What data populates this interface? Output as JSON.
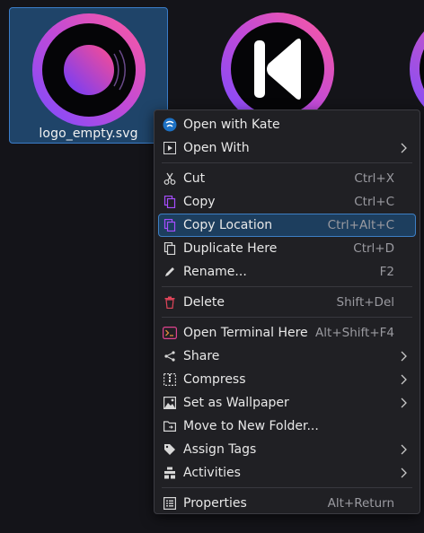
{
  "files": [
    {
      "name": "logo_empty.svg",
      "selected": true,
      "icon": "vinyl-record-icon"
    },
    {
      "name": "",
      "selected": false,
      "icon": "skip-back-icon"
    },
    {
      "name": "",
      "selected": false,
      "icon": "partial-logo-icon"
    }
  ],
  "context_menu": {
    "open_with_kate": {
      "label": "Open with Kate",
      "icon": "kate-icon"
    },
    "open_with": {
      "label": "Open With",
      "icon": "open-with-icon"
    },
    "cut": {
      "label": "Cut",
      "shortcut": "Ctrl+X",
      "icon": "scissors-icon"
    },
    "copy": {
      "label": "Copy",
      "shortcut": "Ctrl+C",
      "icon": "copy-icon"
    },
    "copy_location": {
      "label": "Copy Location",
      "shortcut": "Ctrl+Alt+C",
      "icon": "copy-location-icon"
    },
    "duplicate_here": {
      "label": "Duplicate Here",
      "shortcut": "Ctrl+D",
      "icon": "duplicate-icon"
    },
    "rename": {
      "label": "Rename...",
      "shortcut": "F2",
      "icon": "pencil-icon"
    },
    "delete": {
      "label": "Delete",
      "shortcut": "Shift+Del",
      "icon": "trash-icon"
    },
    "open_terminal": {
      "label": "Open Terminal Here",
      "shortcut": "Alt+Shift+F4",
      "icon": "terminal-icon"
    },
    "share": {
      "label": "Share",
      "icon": "share-icon"
    },
    "compress": {
      "label": "Compress",
      "icon": "compress-icon"
    },
    "set_wallpaper": {
      "label": "Set as Wallpaper",
      "icon": "image-icon"
    },
    "move_to_folder": {
      "label": "Move to New Folder...",
      "icon": "folder-move-icon"
    },
    "assign_tags": {
      "label": "Assign Tags",
      "icon": "tag-icon"
    },
    "activities": {
      "label": "Activities",
      "icon": "activities-icon"
    },
    "properties": {
      "label": "Properties",
      "shortcut": "Alt+Return",
      "icon": "properties-icon"
    }
  },
  "colors": {
    "background": "#141419",
    "menu_bg": "#202024",
    "highlight_bg": "#1d3e5e",
    "highlight_border": "#3d7fc4",
    "accent_purple": "#a64dff",
    "accent_pink": "#e0438f",
    "delete_red": "#e0455a"
  }
}
